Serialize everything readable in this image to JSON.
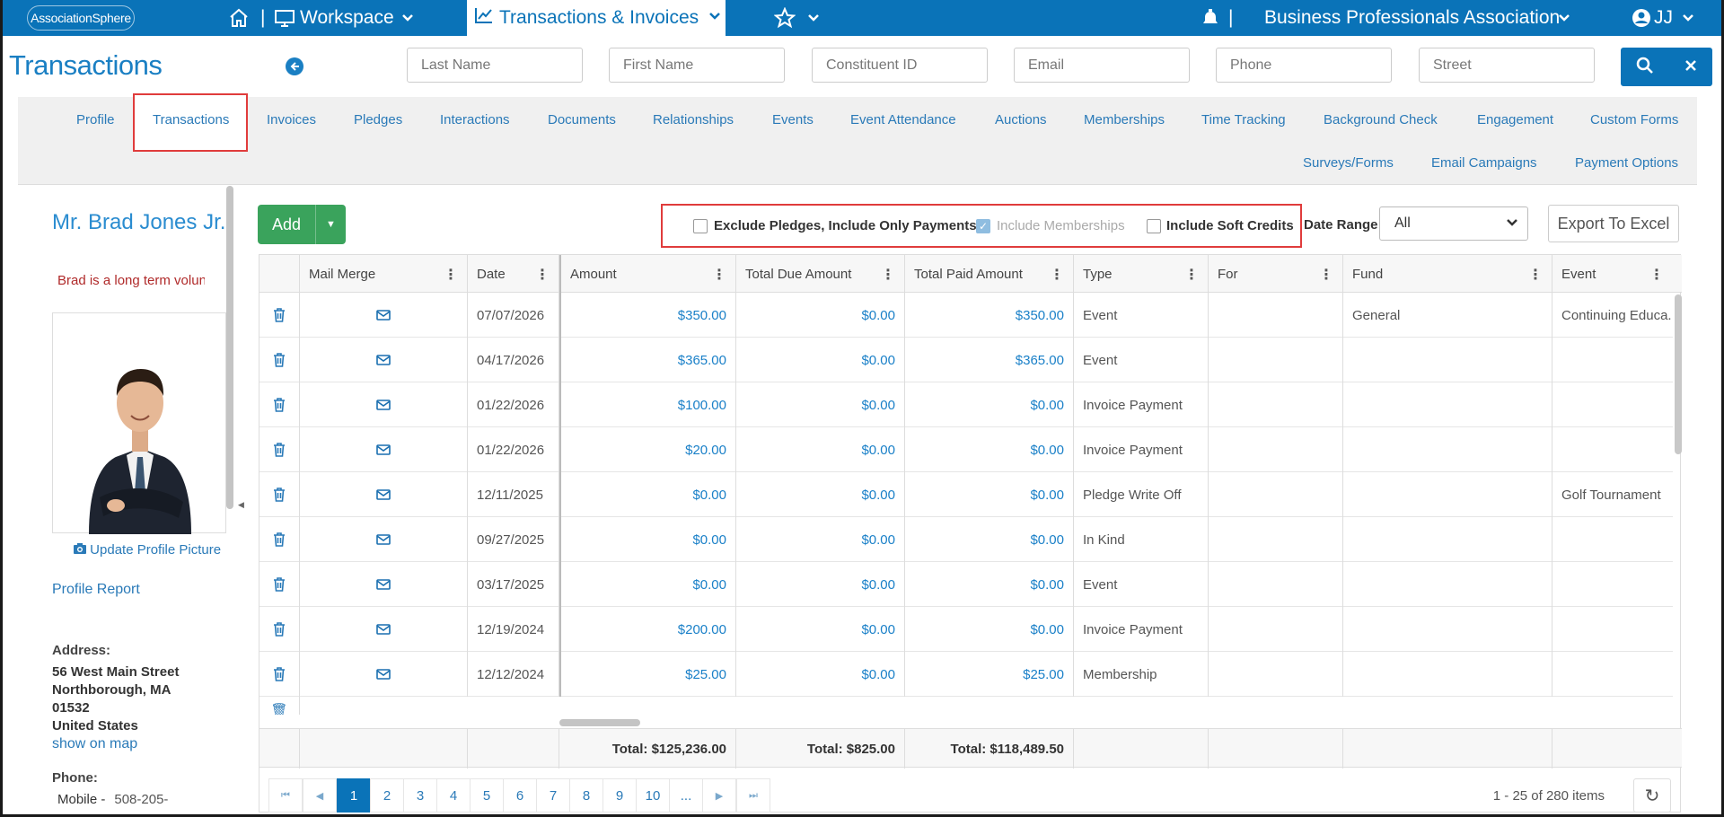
{
  "topnav": {
    "logo": "AssociationSphere",
    "workspace": "Workspace",
    "active_tab": "Transactions & Invoices",
    "org_name": "Business Professionals Association",
    "user_initials": "JJ",
    "sep": "|"
  },
  "header": {
    "title": "Transactions",
    "search": {
      "last_name": "Last Name",
      "first_name": "First Name",
      "constituent_id": "Constituent ID",
      "email": "Email",
      "phone": "Phone",
      "street": "Street"
    }
  },
  "tabs": [
    "Profile",
    "Transactions",
    "Invoices",
    "Pledges",
    "Interactions",
    "Documents",
    "Relationships",
    "Events",
    "Event Attendance",
    "Auctions",
    "Memberships",
    "Time Tracking",
    "Background Check",
    "Engagement",
    "Custom Forms",
    "Surveys/Forms",
    "Email Campaigns",
    "Payment Options"
  ],
  "profile": {
    "name": "Mr. Brad Jones Jr.",
    "tagline": "Brad is a long term volunteer",
    "update_picture": "Update Profile Picture",
    "profile_report": "Profile Report",
    "address_label": "Address:",
    "address_line1": "56 West Main Street",
    "address_line2": "Northborough, MA",
    "address_line3": "01532",
    "address_line4": "United States",
    "show_on_map": "show on map",
    "phone_label": "Phone:",
    "phone_type": "Mobile -",
    "phone_number": "508-205-"
  },
  "toolbar": {
    "add": "Add",
    "exclude_pledges": "Exclude Pledges, Include Only Payments",
    "include_memberships": "Include Memberships",
    "include_soft_credits": "Include Soft Credits",
    "date_range_label": "Date Range",
    "date_range_value": "All",
    "export": "Export To Excel"
  },
  "grid": {
    "columns": [
      "Mail Merge",
      "Date",
      "Amount",
      "Total Due Amount",
      "Total Paid Amount",
      "Type",
      "For",
      "Fund",
      "Event"
    ],
    "rows": [
      {
        "date": "07/07/2026",
        "amount": "$350.00",
        "due": "$0.00",
        "paid": "$350.00",
        "type": "Event",
        "for": "",
        "fund": "General",
        "event": "Continuing Educa..."
      },
      {
        "date": "04/17/2026",
        "amount": "$365.00",
        "due": "$0.00",
        "paid": "$365.00",
        "type": "Event",
        "for": "",
        "fund": "",
        "event": ""
      },
      {
        "date": "01/22/2026",
        "amount": "$100.00",
        "due": "$0.00",
        "paid": "$0.00",
        "type": "Invoice Payment",
        "for": "",
        "fund": "",
        "event": ""
      },
      {
        "date": "01/22/2026",
        "amount": "$20.00",
        "due": "$0.00",
        "paid": "$0.00",
        "type": "Invoice Payment",
        "for": "",
        "fund": "",
        "event": ""
      },
      {
        "date": "12/11/2025",
        "amount": "$0.00",
        "due": "$0.00",
        "paid": "$0.00",
        "type": "Pledge Write Off",
        "for": "",
        "fund": "",
        "event": "Golf Tournament"
      },
      {
        "date": "09/27/2025",
        "amount": "$0.00",
        "due": "$0.00",
        "paid": "$0.00",
        "type": "In Kind",
        "for": "",
        "fund": "",
        "event": ""
      },
      {
        "date": "03/17/2025",
        "amount": "$0.00",
        "due": "$0.00",
        "paid": "$0.00",
        "type": "Event",
        "for": "",
        "fund": "",
        "event": ""
      },
      {
        "date": "12/19/2024",
        "amount": "$200.00",
        "due": "$0.00",
        "paid": "$0.00",
        "type": "Invoice Payment",
        "for": "",
        "fund": "",
        "event": ""
      },
      {
        "date": "12/12/2024",
        "amount": "$25.00",
        "due": "$0.00",
        "paid": "$25.00",
        "type": "Membership",
        "for": "",
        "fund": "",
        "event": ""
      }
    ],
    "totals": {
      "amount": "Total: $125,236.00",
      "due": "Total: $825.00",
      "paid": "Total: $118,489.50"
    }
  },
  "pager": {
    "pages": [
      "1",
      "2",
      "3",
      "4",
      "5",
      "6",
      "7",
      "8",
      "9",
      "10",
      "..."
    ],
    "current_page": "1",
    "info": "1 - 25 of 280 items"
  },
  "colors": {
    "brand_blue": "#0a73b8",
    "add_green": "#3aa35c",
    "highlight_red": "#e03c3c"
  },
  "icons": [
    "home-icon",
    "monitor-icon",
    "chart-icon",
    "star-icon",
    "chevron-down-icon",
    "bell-icon",
    "user-circle-icon",
    "back-arrow-icon",
    "search-icon",
    "close-icon",
    "trash-icon",
    "mail-icon",
    "camera-icon",
    "refresh-icon"
  ]
}
